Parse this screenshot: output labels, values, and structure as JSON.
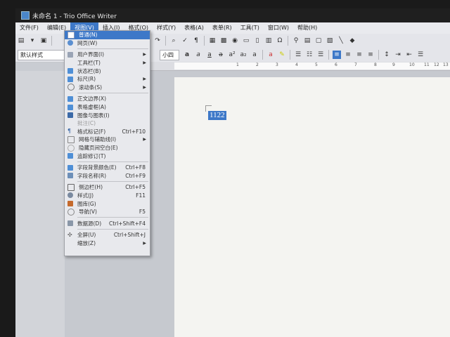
{
  "window": {
    "title": "未命名 1 - Trio Office Writer"
  },
  "menubar": [
    {
      "label": "文件(F)"
    },
    {
      "label": "编辑(E)"
    },
    {
      "label": "视图(V)"
    },
    {
      "label": "插入(I)"
    },
    {
      "label": "格式(O)"
    },
    {
      "label": "样式(Y)"
    },
    {
      "label": "表格(A)"
    },
    {
      "label": "表单(R)"
    },
    {
      "label": "工具(T)"
    },
    {
      "label": "窗口(W)"
    },
    {
      "label": "帮助(H)"
    }
  ],
  "toolbar": {
    "paragraph_style": "默认样式",
    "font_size": "小四"
  },
  "ruler": {
    "numbers": [
      "1",
      "2",
      "3",
      "4",
      "5",
      "6",
      "7",
      "8",
      "9",
      "10",
      "11",
      "12",
      "13",
      "14"
    ]
  },
  "document": {
    "text": "1122"
  },
  "view_menu": {
    "items": [
      {
        "label": "普通(N)",
        "shortcut": "",
        "icon": "normal-view-icon",
        "highlighted": true
      },
      {
        "label": "网页(W)",
        "shortcut": "",
        "icon": "web-view-icon"
      },
      {
        "label": "用户界面(I)",
        "shortcut": "",
        "icon": "ui-icon",
        "submenu": true
      },
      {
        "label": "工具栏(T)",
        "shortcut": "",
        "icon": "",
        "submenu": true
      },
      {
        "label": "状态栏(B)",
        "shortcut": "",
        "icon": "check-icon"
      },
      {
        "label": "标尺(R)",
        "shortcut": "",
        "icon": "check-icon",
        "submenu": true
      },
      {
        "label": "滚动条(S)",
        "shortcut": "",
        "icon": "scrollbar-icon",
        "submenu": true
      },
      {
        "label": "正文边界(X)",
        "shortcut": "",
        "icon": "check-icon"
      },
      {
        "label": "表格虚框(A)",
        "shortcut": "",
        "icon": "check-icon"
      },
      {
        "label": "图像与图表(I)",
        "shortcut": "",
        "icon": "image-icon"
      },
      {
        "label": "批注(C)",
        "shortcut": "",
        "icon": "",
        "disabled": true
      },
      {
        "label": "格式标记(F)",
        "shortcut": "Ctrl+F10",
        "icon": "formatting-marks-icon"
      },
      {
        "label": "网格与辅助线(I)",
        "shortcut": "",
        "icon": "grid-icon",
        "submenu": true
      },
      {
        "label": "隐藏页间空白(E)",
        "shortcut": "",
        "icon": "hide-whitespace-icon"
      },
      {
        "label": "追踪修订(T)",
        "shortcut": "",
        "icon": "check-icon"
      },
      {
        "label": "字段背景颜色(E)",
        "shortcut": "Ctrl+F8",
        "icon": "check-icon"
      },
      {
        "label": "字段名称(R)",
        "shortcut": "Ctrl+F9",
        "icon": "field-name-icon"
      },
      {
        "label": "侧边栏(H)",
        "shortcut": "Ctrl+F5",
        "icon": "sidebar-icon"
      },
      {
        "label": "样式(J)",
        "shortcut": "F11",
        "icon": "styles-icon"
      },
      {
        "label": "图库(G)",
        "shortcut": "",
        "icon": "gallery-icon"
      },
      {
        "label": "导航(V)",
        "shortcut": "F5",
        "icon": "navigator-icon"
      },
      {
        "label": "数据源(D)",
        "shortcut": "Ctrl+Shift+F4",
        "icon": "data-source-icon"
      },
      {
        "label": "全屏(U)",
        "shortcut": "Ctrl+Shift+J",
        "icon": "fullscreen-icon"
      },
      {
        "label": "缩放(Z)",
        "shortcut": "",
        "icon": "",
        "submenu": true
      }
    ]
  },
  "colors": {
    "accent": "#3d78c8",
    "menu_bg": "#e8e9ed",
    "page_bg": "#f4f4f1",
    "check": "#4f8fd6"
  }
}
